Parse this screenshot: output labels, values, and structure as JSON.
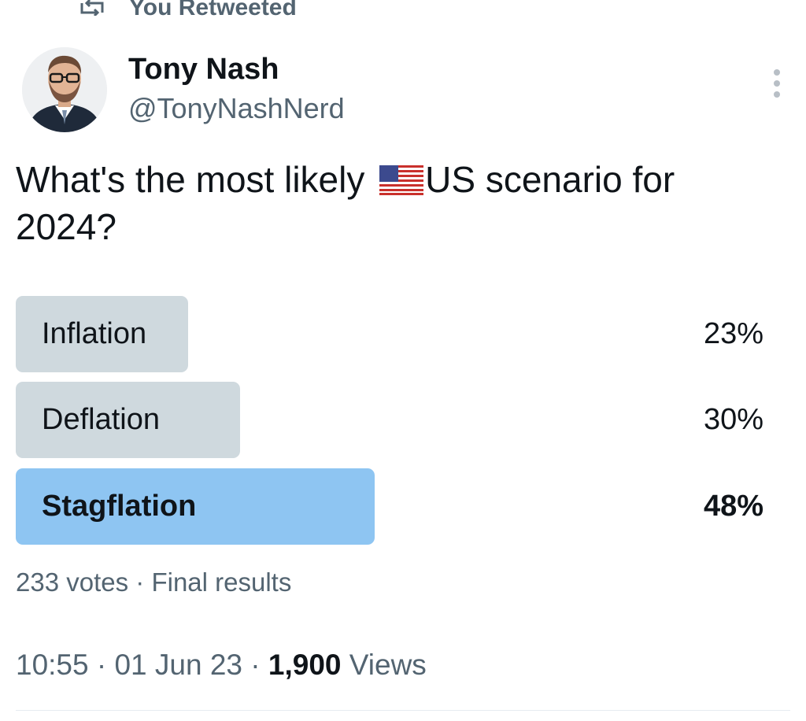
{
  "header": {
    "retweet_label": "You Retweeted"
  },
  "author": {
    "name": "Tony Nash",
    "handle": "@TonyNashNerd"
  },
  "tweet": {
    "text_before_flag": "What's the most likely ",
    "flag_icon": "us-flag-icon",
    "text_after_flag": "US scenario for 2024?"
  },
  "poll": {
    "options": [
      {
        "label": "Inflation",
        "percent_label": "23%",
        "percent": 23,
        "winner": false
      },
      {
        "label": "Deflation",
        "percent_label": "30%",
        "percent": 30,
        "winner": false
      },
      {
        "label": "Stagflation",
        "percent_label": "48%",
        "percent": 48,
        "winner": true
      }
    ],
    "votes": "233 votes",
    "separator": "·",
    "status": "Final results"
  },
  "meta": {
    "time": "10:55",
    "date": "01 Jun 23",
    "sep": " · ",
    "views_count": "1,900",
    "views_label": "Views"
  },
  "colors": {
    "winner_bar": "#8ec5f2",
    "option_bar": "#cfd9de",
    "secondary_text": "#536471",
    "primary_text": "#0f1419"
  }
}
